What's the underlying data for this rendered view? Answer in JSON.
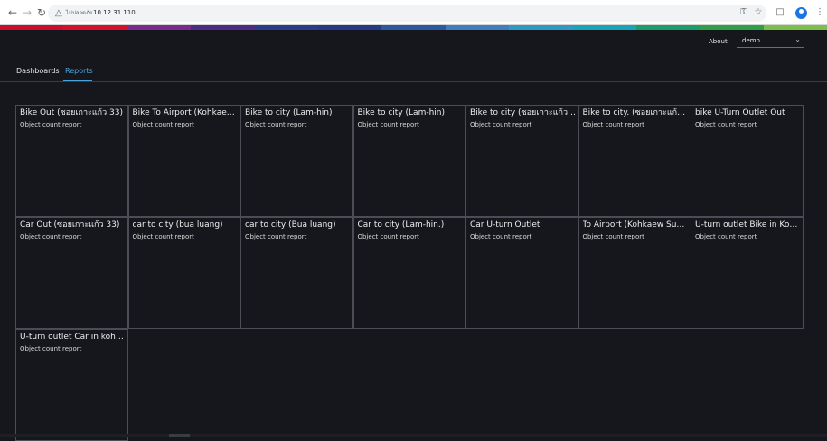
{
  "browser": {
    "back_icon": "back-arrow-icon",
    "forward_icon": "forward-arrow-icon",
    "reload_icon": "reload-icon",
    "security_text": "ไม่ปลอดภัย",
    "url": "10.12.31.110"
  },
  "stripe_colors": [
    "#c8102e",
    "#d4122d",
    "#7a2c8c",
    "#4b2e83",
    "#2a3c8c",
    "#263a86",
    "#2c5aa0",
    "#3d7fc1",
    "#2f9ac6",
    "#16a6b6",
    "#1a9d6a",
    "#2fa04a",
    "#7cc04b"
  ],
  "header": {
    "about_label": "About",
    "user_value": "demo"
  },
  "tabs": [
    {
      "label": "Dashboards",
      "active": false
    },
    {
      "label": "Reports",
      "active": true
    }
  ],
  "reports": [
    {
      "title": "Bike Out (ซอยเกาะแก้ว 33)",
      "subtitle": "Object count report"
    },
    {
      "title": "Bike To Airport (Kohkaew Sub...",
      "subtitle": "Object count report"
    },
    {
      "title": "Bike to city (Lam-hin)",
      "subtitle": "Object count report"
    },
    {
      "title": "Bike to city (Lam-hin)",
      "subtitle": "Object count report"
    },
    {
      "title": "Bike to city (ซอยเกาะแก้ว 33)",
      "subtitle": "Object count report"
    },
    {
      "title": "Bike to city. (ซอยเกาะแก้ว 33)",
      "subtitle": "Object count report"
    },
    {
      "title": "bike U-Turn Outlet Out",
      "subtitle": "Object count report"
    },
    {
      "title": "Car Out (ซอยเกาะแก้ว 33)",
      "subtitle": "Object count report"
    },
    {
      "title": "car to city (bua luang)",
      "subtitle": "Object count report"
    },
    {
      "title": "car to city (Bua luang)",
      "subtitle": "Object count report"
    },
    {
      "title": "Car to city (Lam-hin.)",
      "subtitle": "Object count report"
    },
    {
      "title": "Car U-turn Outlet",
      "subtitle": "Object count report"
    },
    {
      "title": "To Airport (Kohkaew Sub...",
      "subtitle": "Object count report"
    },
    {
      "title": "U-turn outlet Bike in Kohk...",
      "subtitle": "Object count report"
    },
    {
      "title": "U-turn outlet Car in kohk...",
      "subtitle": "Object count report"
    }
  ]
}
